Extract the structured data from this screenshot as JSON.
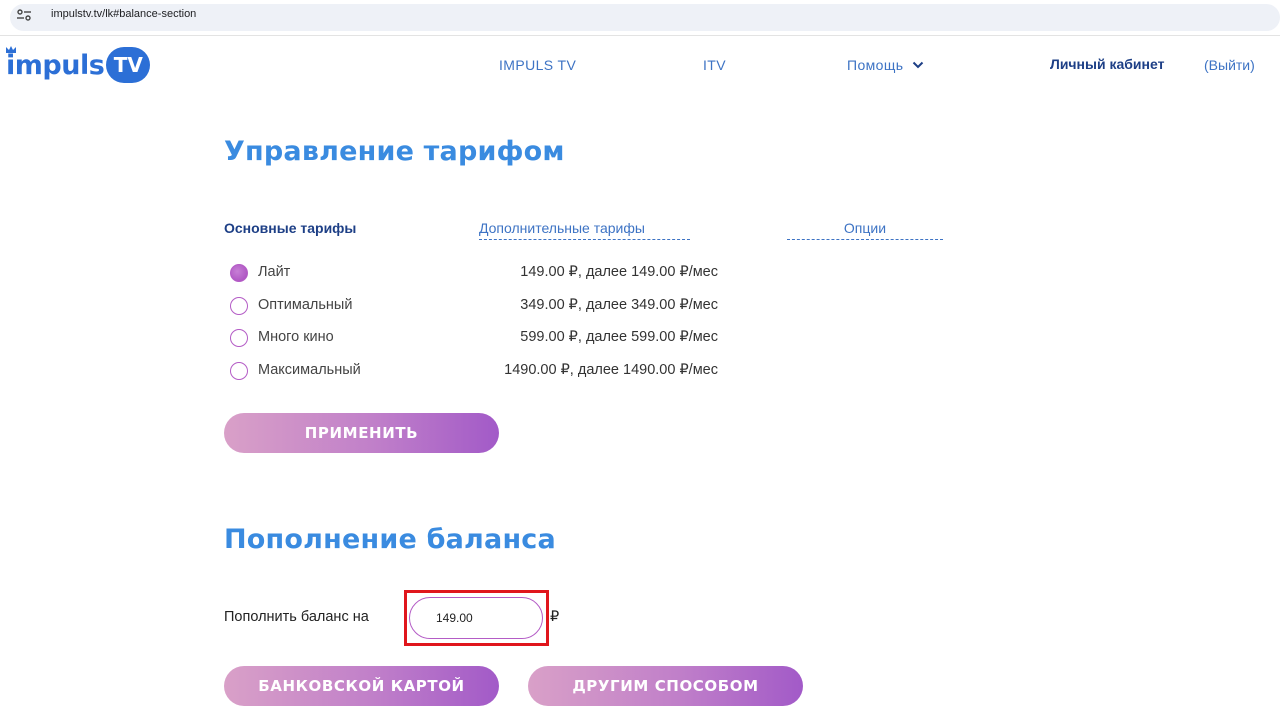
{
  "browser": {
    "url": "impulstv.tv/lk#balance-section",
    "site_icon": "site-settings-icon"
  },
  "header": {
    "logo_text": "impuls",
    "logo_badge": "TV",
    "nav": [
      {
        "label": "IMPULS TV"
      },
      {
        "label": "ITV"
      },
      {
        "label": "Помощь",
        "icon": "chevron-down-icon"
      }
    ],
    "cabinet_label": "Личный кабинет",
    "logout_label": "(Выйти)"
  },
  "tariff_section": {
    "title": "Управление тарифом",
    "tabs": [
      {
        "label": "Основные тарифы",
        "active": true
      },
      {
        "label": "Дополнительные тарифы",
        "active": false
      },
      {
        "label": "Опции",
        "active": false
      }
    ],
    "tariffs": [
      {
        "name": "Лайт",
        "price": "149.00 ₽, далее 149.00 ₽/мес",
        "selected": true
      },
      {
        "name": "Оптимальный",
        "price": "349.00 ₽, далее 349.00 ₽/мес",
        "selected": false
      },
      {
        "name": "Много кино",
        "price": "599.00 ₽, далее 599.00 ₽/мес",
        "selected": false
      },
      {
        "name": "Максимальный",
        "price": "1490.00 ₽, далее 1490.00 ₽/мес",
        "selected": false
      }
    ],
    "apply_label": "ПРИМЕНИТЬ"
  },
  "balance_section": {
    "title": "Пополнение баланса",
    "label": "Пополнить баланс на",
    "amount": "149.00",
    "currency": "₽",
    "card_button": "БАНКОВСКОЙ КАРТОЙ",
    "other_button": "ДРУГИМ СПОСОБОМ"
  },
  "colors": {
    "brand_blue": "#2c6fd6",
    "title_blue": "#3a8be0",
    "accent_purple": "#b45cc6",
    "highlight_red": "#e0161c"
  }
}
